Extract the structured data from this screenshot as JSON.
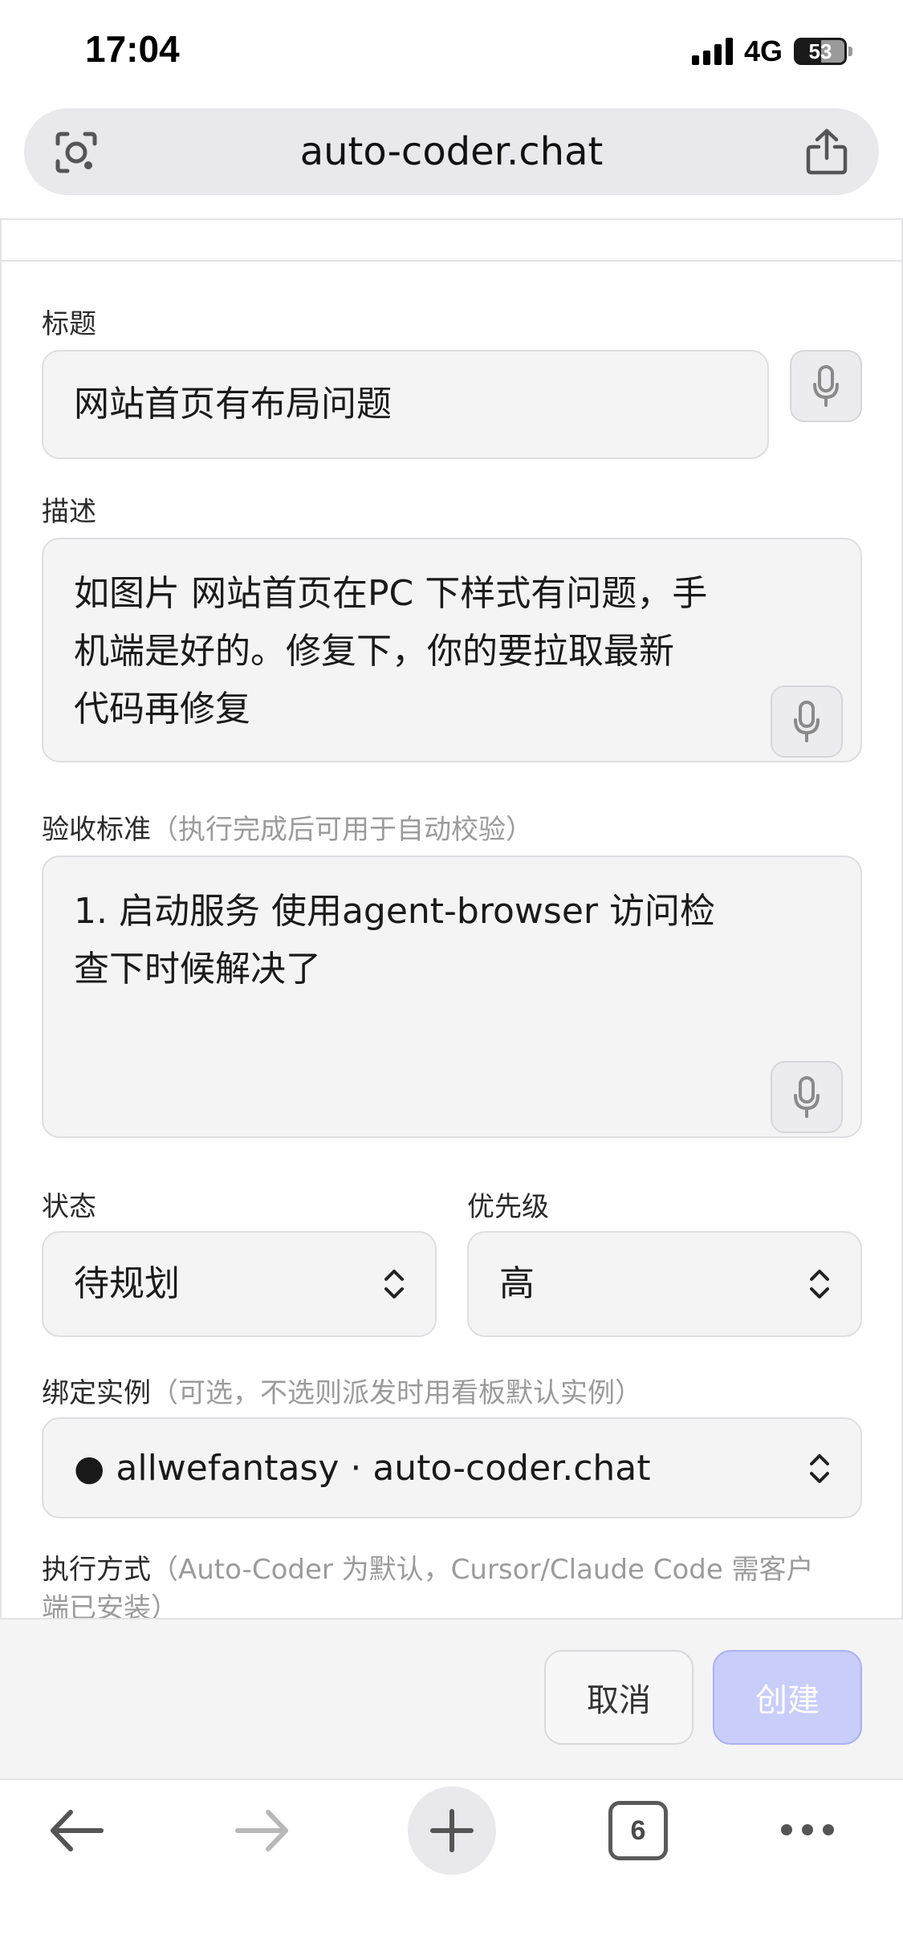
{
  "status_bar": {
    "time": "17:04",
    "network": "4G",
    "battery": "53"
  },
  "browser": {
    "url": "auto-coder.chat",
    "tab_count": "6"
  },
  "form": {
    "title": {
      "label": "标题",
      "value": "网站首页有布局问题"
    },
    "description": {
      "label": "描述",
      "lines": [
        "如图片 网站首页在PC 下样式有问题，手",
        "机端是好的。修复下，你的要拉取最新",
        "代码再修复"
      ]
    },
    "acceptance": {
      "label": "验收标准",
      "hint": "（执行完成后可用于自动校验）",
      "lines": [
        "1.  启动服务 使用agent-browser 访问检",
        "查下时候解决了"
      ]
    },
    "status": {
      "label": "状态",
      "value": "待规划"
    },
    "priority": {
      "label": "优先级",
      "value": "高"
    },
    "instance": {
      "label": "绑定实例",
      "hint": "（可选，不选则派发时用看板默认实例）",
      "value": "● allwefantasy · auto-coder.chat"
    },
    "execution": {
      "label": "执行方式",
      "hint_line1": "（Auto-Coder 为默认，Cursor/Claude Code 需客户",
      "hint_line2": "端已安装）"
    }
  },
  "actions": {
    "cancel": "取消",
    "create": "创建"
  },
  "colors": {
    "field_bg": "#f4f4f5",
    "create_button_bg": "#c9cdfa",
    "hint_text": "#9b9b9b"
  }
}
